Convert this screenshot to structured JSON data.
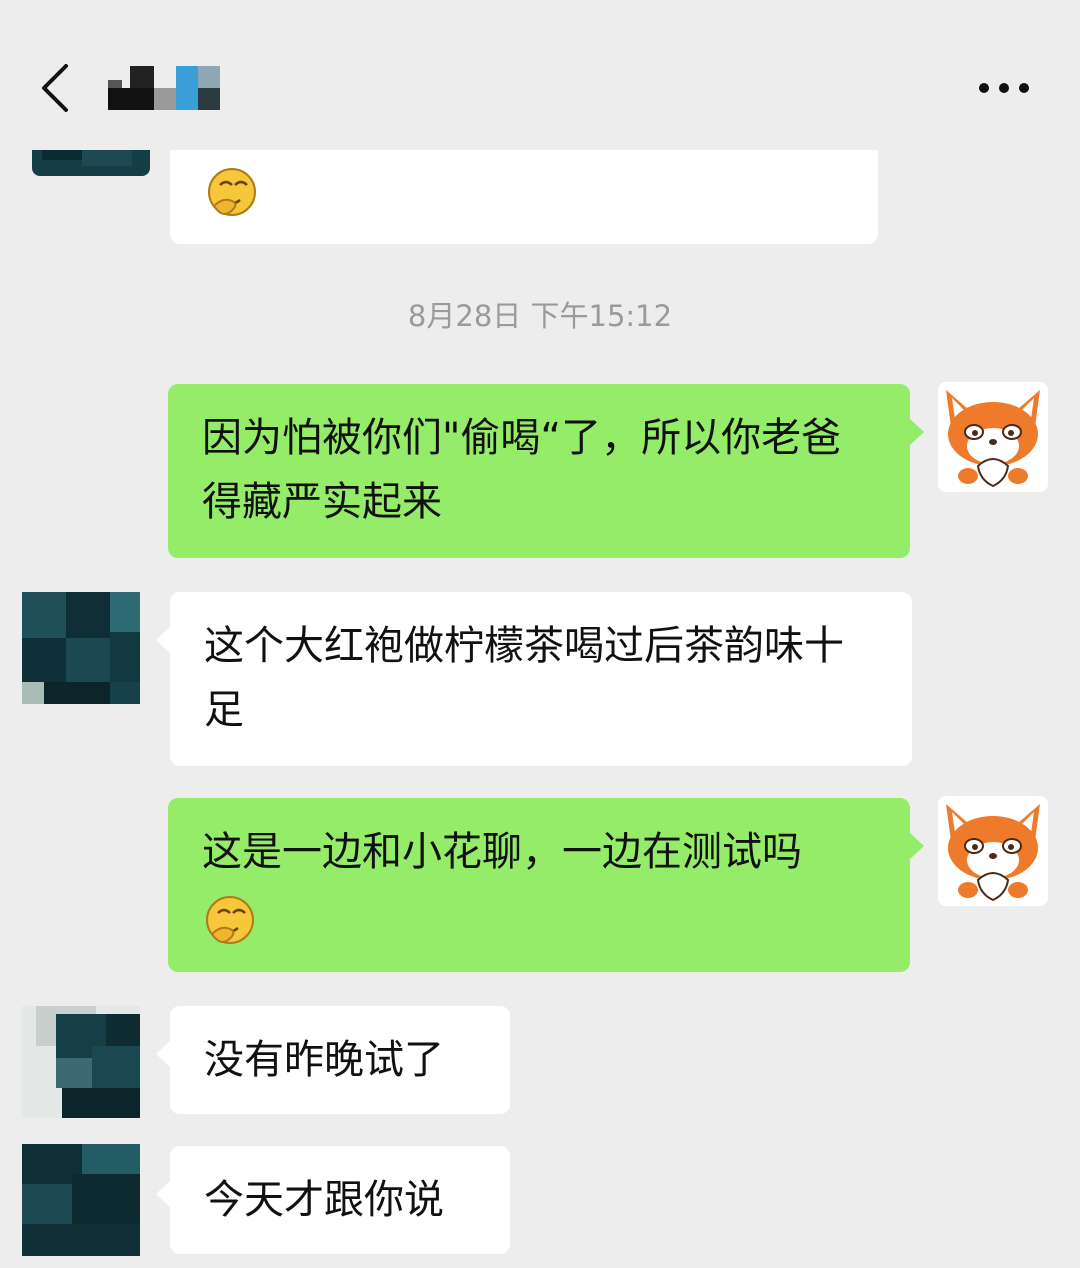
{
  "timestamp": "8月28日 下午15:12",
  "messages": [
    {
      "side": "in",
      "text": ""
    },
    {
      "side": "out",
      "text": "因为怕被你们\"偷喝“了，所以你老爸得藏严实起来"
    },
    {
      "side": "in",
      "text": "这个大红袍做柠檬茶喝过后茶韵味十足"
    },
    {
      "side": "out",
      "text": "这是一边和小花聊，一边在测试吗"
    },
    {
      "side": "in",
      "text": "没有昨晚试了"
    },
    {
      "side": "in",
      "text": "今天才跟你说"
    }
  ],
  "emoji": "thinking-face-emoji",
  "colors": {
    "background": "#ededed",
    "incoming_bubble": "#ffffff",
    "outgoing_bubble": "#95ec69",
    "timestamp_text": "#9a9a9a"
  },
  "icons": {
    "back": "chevron-left-icon",
    "more": "more-dots-icon"
  }
}
